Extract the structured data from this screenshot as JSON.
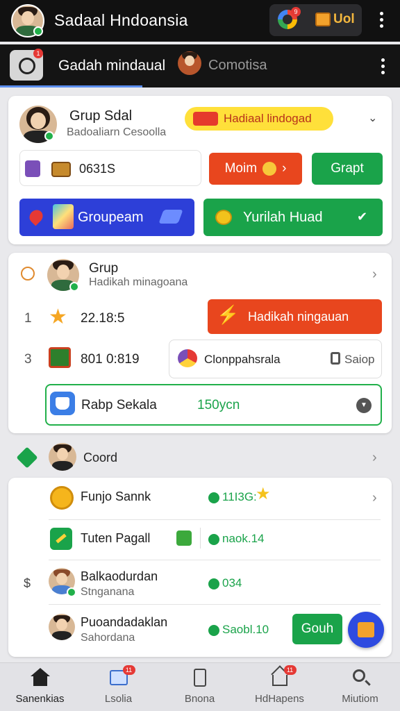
{
  "topbar": {
    "title": "Sadaal Hndoansia",
    "notif_count": "9",
    "coins": "Uol"
  },
  "subbar": {
    "title": "Gadah mindaual",
    "link": "Comotisa",
    "camera_badge": "1"
  },
  "card1": {
    "title": "Grup Sdal",
    "subtitle": "Badoaliarn Cesoolla",
    "badge": "Hadiaal lindogad",
    "stat_value": "0631S",
    "moim_label": "Moim",
    "grupt_label": "Grapt",
    "groupeam_label": "Groupeam",
    "yurilah_label": "Yurilah Huad",
    "check_icon": "check-icon"
  },
  "card2": {
    "title": "Grup",
    "subtitle": "Hadikah minagoana",
    "row1": {
      "num": "1",
      "value": "22.18:5",
      "button": "Hadikah ningauan"
    },
    "row2": {
      "num": "3",
      "value": "801 0:819",
      "label": "Clonppahsrala",
      "save": "Saiop"
    },
    "row3": {
      "label": "Rabp Sekala",
      "value": "150ycn"
    }
  },
  "section": {
    "title": "Coord"
  },
  "list": [
    {
      "title": "Funjo Sannk",
      "subtitle": "",
      "value": "11I3G:"
    },
    {
      "title": "Tuten Pagall",
      "subtitle": "",
      "value": "naok.14"
    },
    {
      "title": "Balkaodurdan",
      "subtitle": "Stnganana",
      "value": "034"
    },
    {
      "title": "Puoandadaklan",
      "subtitle": "Sahordana",
      "value": "Saobl.10",
      "button": "Gouh"
    }
  ],
  "list_prefix": "$",
  "nav": [
    {
      "label": "Sanenkias",
      "icon": "home-icon",
      "badge": ""
    },
    {
      "label": "Lsolia",
      "icon": "image-icon",
      "badge": "11"
    },
    {
      "label": "Bnona",
      "icon": "document-icon",
      "badge": ""
    },
    {
      "label": "HdHapens",
      "icon": "house-icon",
      "badge": "11"
    },
    {
      "label": "Miutiom",
      "icon": "search-icon",
      "badge": ""
    }
  ],
  "colors": {
    "green": "#1aa34a",
    "orange": "#e8461e",
    "blue": "#2d3fd8",
    "yellow": "#ffe03a"
  }
}
